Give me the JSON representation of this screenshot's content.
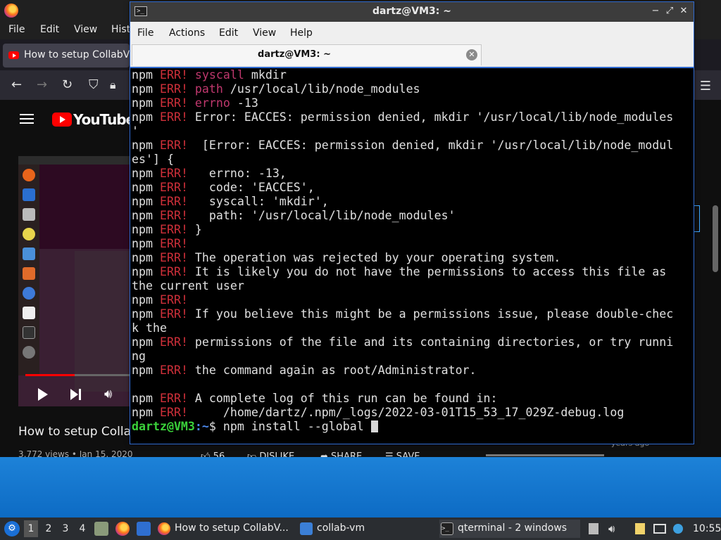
{
  "firefox": {
    "menu": [
      "File",
      "Edit",
      "View",
      "Hist"
    ],
    "tab_title": "How to setup CollabVM",
    "youtube_logo_text": "YouTube",
    "video_title": "How to setup Collab",
    "video_meta": "3,772 views • Jan 15, 2020",
    "actions": {
      "like": "56",
      "dislike": "DISLIKE",
      "share": "SHARE",
      "save": "SAVE"
    },
    "ago": "years ago"
  },
  "terminal": {
    "window_title": "dartz@VM3: ~",
    "menu": [
      "File",
      "Actions",
      "Edit",
      "View",
      "Help"
    ],
    "tab_label": "dartz@VM3: ~",
    "lines": [
      {
        "pfx": "npm ",
        "err": "ERR!",
        "key": " syscall",
        "rest": " mkdir"
      },
      {
        "pfx": "npm ",
        "err": "ERR!",
        "key": " path",
        "rest": " /usr/local/lib/node_modules"
      },
      {
        "pfx": "npm ",
        "err": "ERR!",
        "key": " errno",
        "rest": " -13"
      },
      {
        "pfx": "npm ",
        "err": "ERR!",
        "key": "",
        "rest": " Error: EACCES: permission denied, mkdir '/usr/local/lib/node_modules"
      },
      {
        "pfx": "'",
        "err": "",
        "key": "",
        "rest": ""
      },
      {
        "pfx": "npm ",
        "err": "ERR!",
        "key": "",
        "rest": "  [Error: EACCES: permission denied, mkdir '/usr/local/lib/node_modul"
      },
      {
        "pfx": "es'] {",
        "err": "",
        "key": "",
        "rest": ""
      },
      {
        "pfx": "npm ",
        "err": "ERR!",
        "key": "",
        "rest": "   errno: -13,"
      },
      {
        "pfx": "npm ",
        "err": "ERR!",
        "key": "",
        "rest": "   code: 'EACCES',"
      },
      {
        "pfx": "npm ",
        "err": "ERR!",
        "key": "",
        "rest": "   syscall: 'mkdir',"
      },
      {
        "pfx": "npm ",
        "err": "ERR!",
        "key": "",
        "rest": "   path: '/usr/local/lib/node_modules'"
      },
      {
        "pfx": "npm ",
        "err": "ERR!",
        "key": "",
        "rest": " }"
      },
      {
        "pfx": "npm ",
        "err": "ERR!",
        "key": "",
        "rest": ""
      },
      {
        "pfx": "npm ",
        "err": "ERR!",
        "key": "",
        "rest": " The operation was rejected by your operating system."
      },
      {
        "pfx": "npm ",
        "err": "ERR!",
        "key": "",
        "rest": " It is likely you do not have the permissions to access this file as"
      },
      {
        "pfx": "the current user",
        "err": "",
        "key": "",
        "rest": ""
      },
      {
        "pfx": "npm ",
        "err": "ERR!",
        "key": "",
        "rest": ""
      },
      {
        "pfx": "npm ",
        "err": "ERR!",
        "key": "",
        "rest": " If you believe this might be a permissions issue, please double-chec"
      },
      {
        "pfx": "k the",
        "err": "",
        "key": "",
        "rest": ""
      },
      {
        "pfx": "npm ",
        "err": "ERR!",
        "key": "",
        "rest": " permissions of the file and its containing directories, or try runni"
      },
      {
        "pfx": "ng",
        "err": "",
        "key": "",
        "rest": ""
      },
      {
        "pfx": "npm ",
        "err": "ERR!",
        "key": "",
        "rest": " the command again as root/Administrator."
      },
      {
        "pfx": "",
        "err": "",
        "key": "",
        "rest": ""
      },
      {
        "pfx": "npm ",
        "err": "ERR!",
        "key": "",
        "rest": " A complete log of this run can be found in:"
      },
      {
        "pfx": "npm ",
        "err": "ERR!",
        "key": "",
        "rest": "     /home/dartz/.npm/_logs/2022-03-01T15_53_17_029Z-debug.log"
      }
    ],
    "prompt": {
      "user": "dartz@VM3",
      "path": ":~",
      "symbol": "$ ",
      "command": "npm install --global "
    }
  },
  "taskbar": {
    "workspaces": [
      "1",
      "2",
      "3",
      "4"
    ],
    "tasks": [
      {
        "label": "How to setup CollabV...",
        "icon": "firefox-icon"
      },
      {
        "label": "collab-vm",
        "icon": "folder-icon"
      },
      {
        "label": "qterminal - 2 windows",
        "icon": "terminal-icon"
      }
    ],
    "clock": "10:55"
  },
  "colors": {
    "terminal_bg": "#000000",
    "err": "#d0303a",
    "key": "#c0386e",
    "prompt_user": "#3ad13a",
    "prompt_path": "#4d8bf0",
    "desktop": "#1d82d8",
    "taskbar": "#2a2d31"
  }
}
